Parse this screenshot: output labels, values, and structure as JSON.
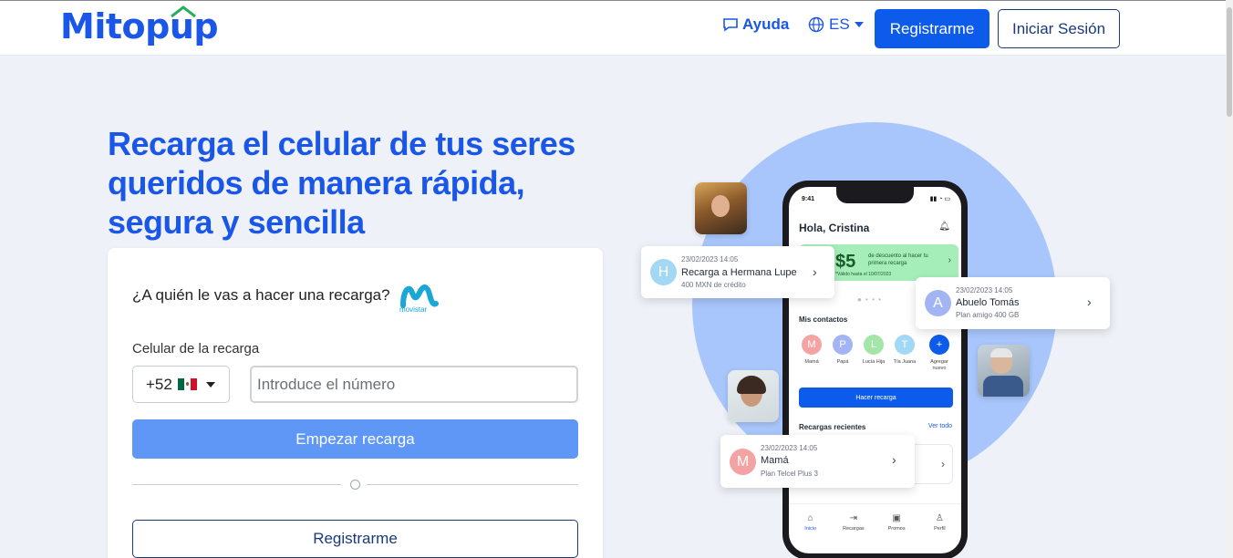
{
  "header": {
    "logo_text": "Mitopup",
    "help_label": "Ayuda",
    "lang_label": "ES",
    "register_label": "Registrarme",
    "login_label": "Iniciar Sesión"
  },
  "hero": {
    "title": "Recarga el celular de tus seres queridos de manera rápida, segura y sencilla"
  },
  "form": {
    "question": "¿A quién le vas a hacer una recarga?",
    "operator_name": "movistar",
    "phone_label": "Celular de la recarga",
    "country_code": "+52",
    "phone_placeholder": "Introduce el número",
    "start_label": "Empezar recarga",
    "register_label": "Registrarme"
  },
  "phone_app": {
    "time": "9:41",
    "greeting": "Hola, Cristina",
    "promo_amount": "$5",
    "promo_text": "de descuento al hacer tu primera recarga",
    "promo_validity": "*Válido hasta el 10/07/2023",
    "contacts_title": "Mis contactos",
    "contacts": [
      {
        "initial": "M",
        "name": "Mamá",
        "color": "#f4a3a3"
      },
      {
        "initial": "P",
        "name": "Papá",
        "color": "#a3b4f4"
      },
      {
        "initial": "L",
        "name": "Lucía Hija",
        "color": "#a3e6a8"
      },
      {
        "initial": "T",
        "name": "Tía Juana",
        "color": "#a3d8f4"
      },
      {
        "initial": "+",
        "name": "Agregar nuevo",
        "color": "#0d5bea"
      }
    ],
    "recharge_button": "Hacer recarga",
    "recent_title": "Recargas recientes",
    "see_all": "Ver todo",
    "nav": [
      "Inicio",
      "Recargas",
      "Promos",
      "Perfil"
    ]
  },
  "float_cards": [
    {
      "initial": "H",
      "date": "23/02/2023 14:05",
      "name": "Recarga a Hermana Lupe",
      "sub": "400 MXN de crédito",
      "color": "#a3d8f4"
    },
    {
      "initial": "A",
      "date": "23/02/2023 14:05",
      "name": "Abuelo Tomás",
      "sub": "Plan amigo 400 GB",
      "color": "#a3b4f4"
    },
    {
      "initial": "M",
      "date": "23/02/2023 14:05",
      "name": "Mamá",
      "sub": "Plan Telcel Plus 3",
      "color": "#f4a3a3"
    }
  ],
  "colors": {
    "brand": "#1a56e8",
    "primary_button": "#0d5bea",
    "start_button": "#5f97f6",
    "background": "#eef2f8",
    "circle": "#a8c6fb"
  }
}
